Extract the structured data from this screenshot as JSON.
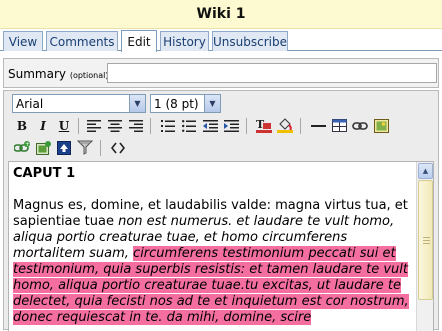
{
  "title": "Wiki 1",
  "tabs": [
    {
      "label": "View"
    },
    {
      "label": "Comments"
    },
    {
      "label": "Edit"
    },
    {
      "label": "History"
    },
    {
      "label": "Unsubscribe"
    }
  ],
  "active_tab": "Edit",
  "summary": {
    "label": "Summary",
    "optional": "(optional)",
    "value": ""
  },
  "toolbar": {
    "font_family": "Arial",
    "font_size": "1 (8 pt)",
    "bold": "B",
    "italic": "I",
    "underline": "U"
  },
  "content": {
    "heading": "CAPUT 1",
    "plain_1": "Magnus es, domine, et laudabilis valde: magna virtus tua, et sapientiae tuae ",
    "italic_1": "non est numerus. et laudare te vult homo, aliqua portio creaturae tuae, et homo circumferens mortalitem suam, ",
    "highlight_1": "circumferens testimonium peccati sui et testimonium, quia superbis resistis: et tamen laudare te vult homo, aliqua portio creaturae tuae.tu excitas, ut laudare te delectet, quia fecisti nos ad te et inquietum est cor nostrum, donec requiescat in te. da mihi, domine, scire",
    "highlight_color": "#f46fa0"
  }
}
